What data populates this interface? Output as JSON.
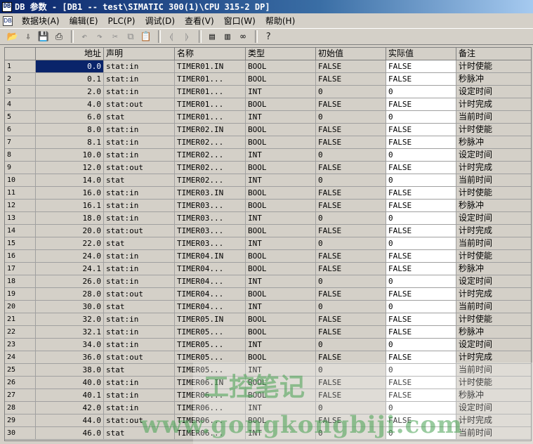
{
  "window": {
    "icon_text": "DB",
    "title": "DB 参数 - [DB1 -- test\\SIMATIC 300(1)\\CPU 315-2 DP]"
  },
  "menu": {
    "doc_icon_text": "DB",
    "items": [
      "数据块(A)",
      "编辑(E)",
      "PLC(P)",
      "调试(D)",
      "查看(V)",
      "窗口(W)",
      "帮助(H)"
    ]
  },
  "toolbar": {
    "buttons": [
      {
        "name": "open-icon",
        "glyph": "📂",
        "enabled": true
      },
      {
        "name": "download-icon",
        "glyph": "⇩",
        "enabled": true
      },
      {
        "name": "save-icon",
        "glyph": "💾",
        "enabled": true
      },
      {
        "name": "print-icon",
        "glyph": "⎙",
        "enabled": true
      },
      {
        "name": "undo-icon",
        "glyph": "↶",
        "enabled": false
      },
      {
        "name": "redo-icon",
        "glyph": "↷",
        "enabled": false
      },
      {
        "name": "cut-icon",
        "glyph": "✂",
        "enabled": false
      },
      {
        "name": "copy-icon",
        "glyph": "⧉",
        "enabled": false
      },
      {
        "name": "paste-icon",
        "glyph": "📋",
        "enabled": false
      },
      {
        "name": "toggle-prev-icon",
        "glyph": "⦉",
        "enabled": false
      },
      {
        "name": "toggle-next-icon",
        "glyph": "⦊",
        "enabled": false
      },
      {
        "name": "monitor-icon",
        "glyph": "▤",
        "enabled": true
      },
      {
        "name": "monitor-values-icon",
        "glyph": "▥",
        "enabled": true
      },
      {
        "name": "glasses-icon",
        "glyph": "∞",
        "enabled": true
      },
      {
        "name": "help-icon",
        "glyph": "?",
        "enabled": true
      }
    ]
  },
  "table": {
    "headers": [
      "",
      "地址",
      "声明",
      "名称",
      "类型",
      "初始值",
      "实际值",
      "备注"
    ],
    "rows": [
      [
        "1",
        "0.0",
        "stat:in",
        "TIMER01.IN",
        "BOOL",
        "FALSE",
        "FALSE",
        "计时使能"
      ],
      [
        "2",
        "0.1",
        "stat:in",
        "TIMER01...",
        "BOOL",
        "FALSE",
        "FALSE",
        "秒脉冲"
      ],
      [
        "3",
        "2.0",
        "stat:in",
        "TIMER01...",
        "INT",
        "0",
        "0",
        "设定时间"
      ],
      [
        "4",
        "4.0",
        "stat:out",
        "TIMER01...",
        "BOOL",
        "FALSE",
        "FALSE",
        "计时完成"
      ],
      [
        "5",
        "6.0",
        "stat",
        "TIMER01...",
        "INT",
        "0",
        "0",
        "当前时间"
      ],
      [
        "6",
        "8.0",
        "stat:in",
        "TIMER02.IN",
        "BOOL",
        "FALSE",
        "FALSE",
        "计时使能"
      ],
      [
        "7",
        "8.1",
        "stat:in",
        "TIMER02...",
        "BOOL",
        "FALSE",
        "FALSE",
        "秒脉冲"
      ],
      [
        "8",
        "10.0",
        "stat:in",
        "TIMER02...",
        "INT",
        "0",
        "0",
        "设定时间"
      ],
      [
        "9",
        "12.0",
        "stat:out",
        "TIMER02...",
        "BOOL",
        "FALSE",
        "FALSE",
        "计时完成"
      ],
      [
        "10",
        "14.0",
        "stat",
        "TIMER02...",
        "INT",
        "0",
        "0",
        "当前时间"
      ],
      [
        "11",
        "16.0",
        "stat:in",
        "TIMER03.IN",
        "BOOL",
        "FALSE",
        "FALSE",
        "计时使能"
      ],
      [
        "12",
        "16.1",
        "stat:in",
        "TIMER03...",
        "BOOL",
        "FALSE",
        "FALSE",
        "秒脉冲"
      ],
      [
        "13",
        "18.0",
        "stat:in",
        "TIMER03...",
        "INT",
        "0",
        "0",
        "设定时间"
      ],
      [
        "14",
        "20.0",
        "stat:out",
        "TIMER03...",
        "BOOL",
        "FALSE",
        "FALSE",
        "计时完成"
      ],
      [
        "15",
        "22.0",
        "stat",
        "TIMER03...",
        "INT",
        "0",
        "0",
        "当前时间"
      ],
      [
        "16",
        "24.0",
        "stat:in",
        "TIMER04.IN",
        "BOOL",
        "FALSE",
        "FALSE",
        "计时使能"
      ],
      [
        "17",
        "24.1",
        "stat:in",
        "TIMER04...",
        "BOOL",
        "FALSE",
        "FALSE",
        "秒脉冲"
      ],
      [
        "18",
        "26.0",
        "stat:in",
        "TIMER04...",
        "INT",
        "0",
        "0",
        "设定时间"
      ],
      [
        "19",
        "28.0",
        "stat:out",
        "TIMER04...",
        "BOOL",
        "FALSE",
        "FALSE",
        "计时完成"
      ],
      [
        "20",
        "30.0",
        "stat",
        "TIMER04...",
        "INT",
        "0",
        "0",
        "当前时间"
      ],
      [
        "21",
        "32.0",
        "stat:in",
        "TIMER05.IN",
        "BOOL",
        "FALSE",
        "FALSE",
        "计时使能"
      ],
      [
        "22",
        "32.1",
        "stat:in",
        "TIMER05...",
        "BOOL",
        "FALSE",
        "FALSE",
        "秒脉冲"
      ],
      [
        "23",
        "34.0",
        "stat:in",
        "TIMER05...",
        "INT",
        "0",
        "0",
        "设定时间"
      ],
      [
        "24",
        "36.0",
        "stat:out",
        "TIMER05...",
        "BOOL",
        "FALSE",
        "FALSE",
        "计时完成"
      ],
      [
        "25",
        "38.0",
        "stat",
        "TIMER05...",
        "INT",
        "0",
        "0",
        "当前时间"
      ],
      [
        "26",
        "40.0",
        "stat:in",
        "TIMER06.IN",
        "BOOL",
        "FALSE",
        "FALSE",
        "计时使能"
      ],
      [
        "27",
        "40.1",
        "stat:in",
        "TIMER06...",
        "BOOL",
        "FALSE",
        "FALSE",
        "秒脉冲"
      ],
      [
        "28",
        "42.0",
        "stat:in",
        "TIMER06...",
        "INT",
        "0",
        "0",
        "设定时间"
      ],
      [
        "29",
        "44.0",
        "stat:out",
        "TIMER06...",
        "BOOL",
        "FALSE",
        "FALSE",
        "计时完成"
      ],
      [
        "30",
        "46.0",
        "stat",
        "TIMER06...",
        "INT",
        "0",
        "0",
        "当前时间"
      ]
    ],
    "selected_row": 0
  },
  "watermark": {
    "line1": "工控笔记",
    "line2": "www.gongkongbiji.com"
  }
}
